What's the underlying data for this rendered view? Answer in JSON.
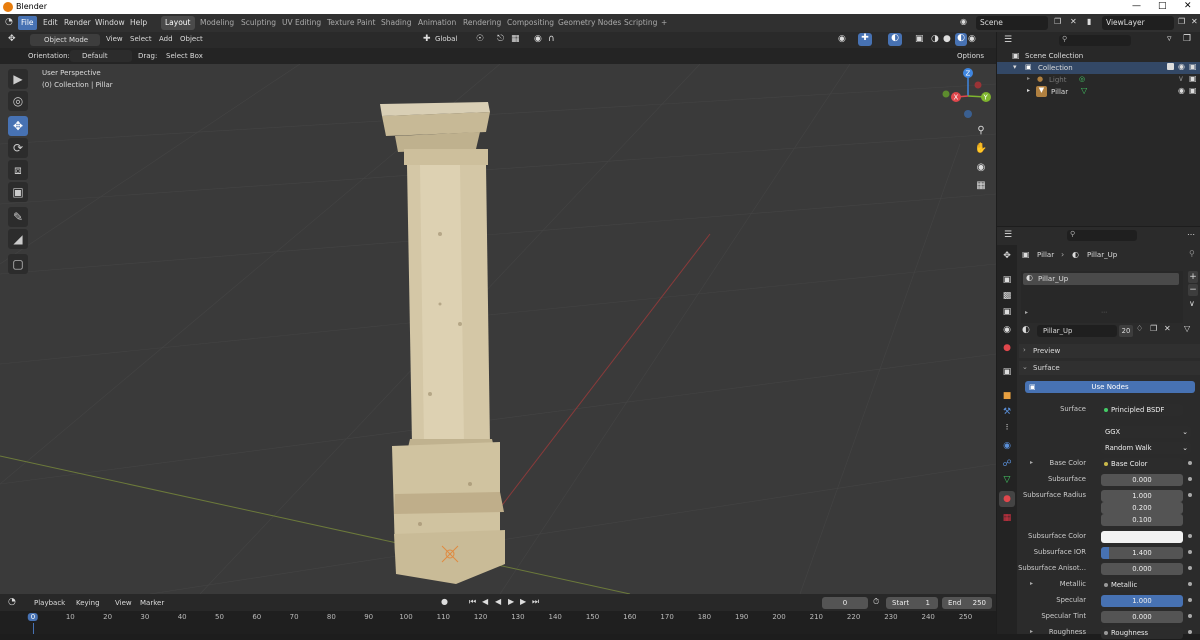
{
  "window": {
    "title": "Blender"
  },
  "menu": {
    "items": [
      "File",
      "Edit",
      "Render",
      "Window",
      "Help"
    ]
  },
  "workspaces": [
    "Layout",
    "Modeling",
    "Sculpting",
    "UV Editing",
    "Texture Paint",
    "Shading",
    "Animation",
    "Rendering",
    "Compositing",
    "Geometry Nodes",
    "Scripting",
    "+"
  ],
  "scene": {
    "label": "Scene",
    "view_layer": "ViewLayer"
  },
  "viewport_header": {
    "mode": "Object Mode",
    "menus": [
      "View",
      "Select",
      "Add",
      "Object"
    ],
    "transform_orientation": "Global"
  },
  "toolbar": {
    "orientation_label": "Orientation:",
    "orientation_value": "Default",
    "drag_label": "Drag:",
    "drag_value": "Select Box",
    "options": "Options"
  },
  "viewport": {
    "perspective": "User Perspective",
    "collection_info": "(0) Collection | Pillar"
  },
  "gizmo": {
    "x": "X",
    "y": "Y",
    "z": "Z"
  },
  "outliner": {
    "root": "Scene Collection",
    "items": [
      {
        "name": "Collection"
      },
      {
        "name": "Light"
      },
      {
        "name": "Pillar"
      }
    ]
  },
  "timeline": {
    "menus": [
      "Playback",
      "Keying",
      "View",
      "Marker"
    ],
    "current_frame": "0",
    "start_label": "Start",
    "start": "1",
    "end_label": "End",
    "end": "250",
    "ruler": [
      "0",
      "10",
      "20",
      "30",
      "40",
      "50",
      "60",
      "70",
      "80",
      "90",
      "100",
      "110",
      "120",
      "130",
      "140",
      "150",
      "160",
      "170",
      "180",
      "190",
      "200",
      "210",
      "220",
      "230",
      "240",
      "250"
    ]
  },
  "properties": {
    "breadcrumb_object": "Pillar",
    "breadcrumb_material": "Pillar_Up",
    "slot": "Pillar_Up",
    "material_name": "Pillar_Up",
    "users": "20",
    "panels": {
      "preview": "Preview",
      "surface": "Surface"
    },
    "use_nodes": "Use Nodes",
    "rows": [
      {
        "label": "Surface",
        "value": "Principled BSDF"
      },
      {
        "label": "",
        "value": "GGX"
      },
      {
        "label": "",
        "value": "Random Walk"
      },
      {
        "label": "Base Color",
        "value": "Base Color"
      },
      {
        "label": "Subsurface",
        "value": "0.000"
      },
      {
        "label": "Subsurface Radius",
        "value": "1.000"
      },
      {
        "label": "",
        "value": "0.200"
      },
      {
        "label": "",
        "value": "0.100"
      },
      {
        "label": "Subsurface Color",
        "value": ""
      },
      {
        "label": "Subsurface IOR",
        "value": "1.400"
      },
      {
        "label": "Subsurface Anisot...",
        "value": "0.000"
      },
      {
        "label": "Metallic",
        "value": "Metallic"
      },
      {
        "label": "Specular",
        "value": "1.000"
      },
      {
        "label": "Specular Tint",
        "value": "0.000"
      },
      {
        "label": "Roughness",
        "value": "Roughness"
      }
    ]
  },
  "colors": {
    "accent": "#4772b3",
    "header": "#303030",
    "viewport": "#3a3a3a",
    "x_axis": "#e0474c",
    "y_axis": "#7fb52e",
    "z_axis": "#3f86e0"
  }
}
